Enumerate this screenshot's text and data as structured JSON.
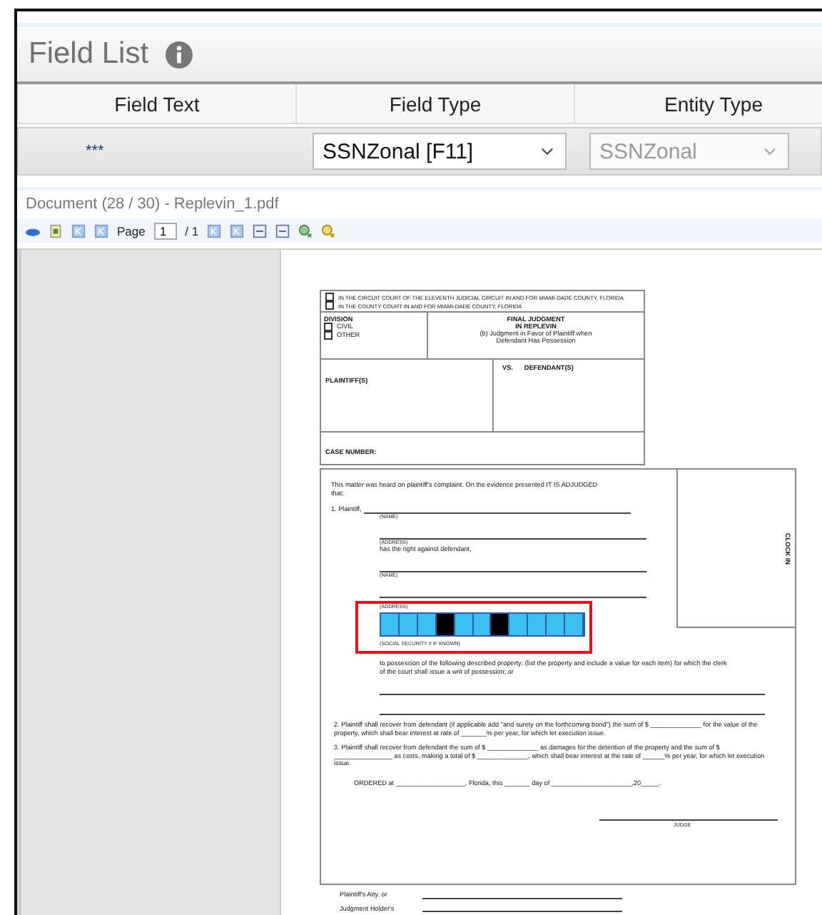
{
  "panel": {
    "title": "Field List"
  },
  "columns": [
    "Field Text",
    "Field Type",
    "Entity Type"
  ],
  "rows": [
    {
      "field_text": "***",
      "field_type": "SSNZonal [F11]",
      "entity_type": "SSNZonal",
      "entity_disabled": true
    }
  ],
  "document": {
    "title": "Document (28 / 30) - Replevin_1.pdf",
    "page_label": "Page",
    "page": "1",
    "page_total": "/ 1"
  },
  "form": {
    "courts": [
      {
        "label": "IN THE CIRCUIT COURT OF THE ELEVENTH JUDICIAL CIRCUIT IN AND FOR MIAMI-DADE COUNTY, FLORIDA",
        "checked": false
      },
      {
        "label": "IN THE COUNTY COURT IN AND FOR MIAMI-DADE COUNTY, FLORIDA",
        "checked": false
      }
    ],
    "division_label": "DIVISION",
    "divisions": [
      {
        "label": "CIVIL",
        "checked": false
      },
      {
        "label": "OTHER",
        "checked": false
      }
    ],
    "title_lines": [
      "FINAL JUDGMENT",
      "IN REPLEVIN"
    ],
    "subtitle_lines": [
      "(b) Judgment in Favor of Plaintiff when",
      "Defendant Has Possession"
    ],
    "plaintiff_label": "PLAINTIFF(S)",
    "vs": "VS.",
    "defendant_label": "DEFENDANT(S)",
    "case_label": "CASE NUMBER:",
    "clock_in": "CLOCK IN",
    "intro": "This matter was heard on plaintiff's complaint. On the evidence presented IT IS ADJUDGED that:",
    "item1": "1.  Plaintiff,",
    "name1": "(NAME)",
    "address1": "(ADDRESS)",
    "right_text": "has the right against defendant,",
    "name2": "(NAME)",
    "address2": "(ADDRESS)",
    "ssn": {
      "highlighted": true,
      "cells": [
        {
          "filled": false
        },
        {
          "filled": false
        },
        {
          "filled": false
        },
        {
          "filled": true
        },
        {
          "filled": false
        },
        {
          "filled": false
        },
        {
          "filled": true
        },
        {
          "filled": false
        },
        {
          "filled": false
        },
        {
          "filled": false
        },
        {
          "filled": false
        }
      ],
      "caption": "(SOCIAL SECURITY # IF KNOWN)"
    },
    "possession": "to possession of the following described property: (list the property and include a value for each item) for which the clerk of the court shall issue a writ of possession; or",
    "items": [
      "2.  Plaintiff shall recover from defendant (if applicable add \"and surety on the forthcoming bond\") the sum of $ ______________ for the value of the property, which shall bear interest at rate of _______% per year, for which let execution issue.",
      "3.  Plaintiff shall recover from defendant the sum of $ ______________ as damages for the detention of the property and the sum of $ ________________ as costs, making a total of $ ______________, which shall bear interest at the rate of ______% per year, for which let execution issue."
    ],
    "ordered": "ORDERED at ___________________, Florida, this _______ day of ______________________,20_____.",
    "judge": "JUDGE",
    "footer_lines": [
      "Plaintiff's Atty. or",
      "Judgment Holder's"
    ]
  }
}
